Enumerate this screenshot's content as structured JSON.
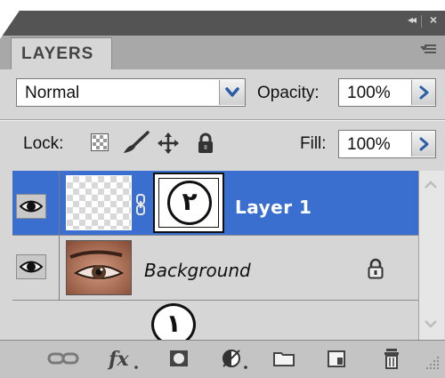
{
  "panel": {
    "title": "LAYERS",
    "collapse_glyph": "◂◂",
    "close_glyph": "×"
  },
  "options": {
    "blend_mode": "Normal",
    "opacity_label": "Opacity:",
    "opacity_value": "100%",
    "lock_label": "Lock:",
    "fill_label": "Fill:",
    "fill_value": "100%"
  },
  "layers": [
    {
      "name": "Layer 1",
      "selected": true,
      "visible": true,
      "has_mask": true
    },
    {
      "name": "Background",
      "selected": false,
      "visible": true,
      "locked": true
    }
  ],
  "annotations": {
    "marker_1": "١",
    "marker_2": "٢"
  },
  "bottom_icons": [
    "link-icon",
    "fx-icon",
    "add-mask-icon",
    "adjustment-layer-icon",
    "group-folder-icon",
    "new-layer-icon",
    "trash-icon"
  ],
  "colors": {
    "selected_row": "#3a6fcf",
    "panel": "#d6d6d6",
    "title_bar": "#545454"
  }
}
